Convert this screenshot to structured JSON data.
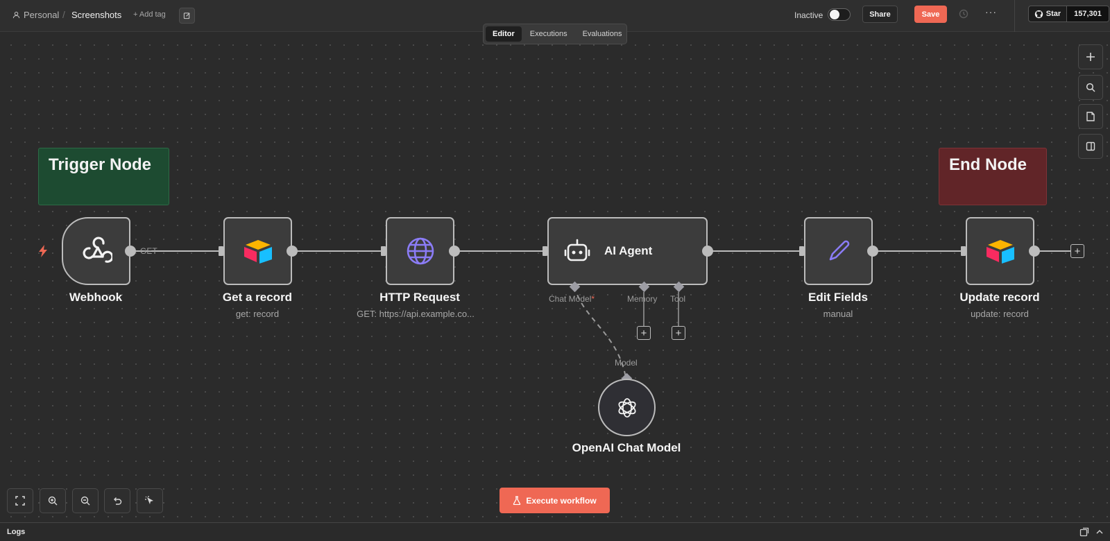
{
  "header": {
    "project": "Personal",
    "separator": "/",
    "workflow_name": "Screenshots",
    "add_tag": "+ Add tag",
    "status_label": "Inactive",
    "share": "Share",
    "save": "Save",
    "more": "···",
    "github_star": "Star",
    "github_count": "157,301"
  },
  "tabs": [
    "Editor",
    "Executions",
    "Evaluations"
  ],
  "active_tab": "Editor",
  "sticky_notes": [
    {
      "text": "Trigger Node",
      "color": "#1d4b31"
    },
    {
      "text": "End Node",
      "color": "#612528"
    }
  ],
  "nodes": {
    "webhook": {
      "title": "Webhook",
      "icon": "webhook-icon"
    },
    "get_record": {
      "title": "Get a record",
      "subtitle": "get: record",
      "icon": "airtable-icon"
    },
    "http_request": {
      "title": "HTTP Request",
      "subtitle": "GET: https://api.example.co...",
      "icon": "globe-icon"
    },
    "ai_agent": {
      "title": "AI Agent",
      "icon": "robot-icon",
      "ports": {
        "chat_model": "Chat Model",
        "required_mark": "*",
        "memory": "Memory",
        "tool": "Tool"
      }
    },
    "edit_fields": {
      "title": "Edit Fields",
      "subtitle": "manual",
      "icon": "pencil-icon"
    },
    "update_record": {
      "title": "Update record",
      "subtitle": "update: record",
      "icon": "airtable-icon"
    },
    "openai_model": {
      "title": "OpenAI Chat Model",
      "port_label": "Model",
      "icon": "openai-icon"
    }
  },
  "connections": {
    "webhook_method": "GET"
  },
  "execute_button": "Execute workflow",
  "logs": {
    "title": "Logs"
  },
  "colors": {
    "accent": "#ef6854",
    "canvas": "#2b2b2b",
    "node_border": "#bcbcbc",
    "trigger_bolt": "#ef6854",
    "http_globe": "#8b7cf6",
    "edit_pencil": "#8b7cf6"
  }
}
